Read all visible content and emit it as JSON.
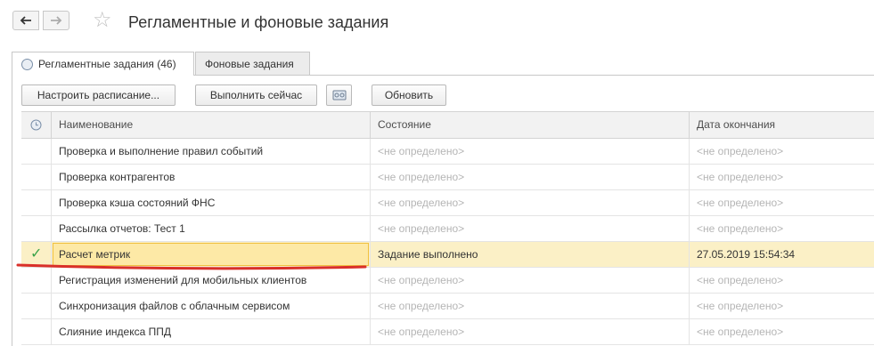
{
  "header": {
    "title": "Регламентные и фоновые задания"
  },
  "tabs": [
    {
      "label": "Регламентные задания (46)"
    },
    {
      "label": "Фоновые задания"
    }
  ],
  "toolbar": {
    "schedule_label": "Настроить расписание...",
    "run_label": "Выполнить сейчас",
    "refresh_label": "Обновить"
  },
  "table": {
    "columns": [
      "Наименование",
      "Состояние",
      "Дата окончания"
    ],
    "rows": [
      {
        "name": "Проверка и выполнение правил событий",
        "state": "<не определено>",
        "end": "<не определено>",
        "check": ""
      },
      {
        "name": "Проверка контрагентов",
        "state": "<не определено>",
        "end": "<не определено>",
        "check": ""
      },
      {
        "name": "Проверка кэша состояний ФНС",
        "state": "<не определено>",
        "end": "<не определено>",
        "check": ""
      },
      {
        "name": "Рассылка отчетов: Тест 1",
        "state": "<не определено>",
        "end": "<не определено>",
        "check": ""
      },
      {
        "name": "Расчет метрик",
        "state": "Задание выполнено",
        "end": "27.05.2019 15:54:34",
        "check": "✓"
      },
      {
        "name": "Регистрация изменений для мобильных клиентов",
        "state": "<не определено>",
        "end": "<не определено>",
        "check": ""
      },
      {
        "name": "Синхронизация файлов с облачным сервисом",
        "state": "<не определено>",
        "end": "<не определено>",
        "check": ""
      },
      {
        "name": "Слияние индекса ППД",
        "state": "<не определено>",
        "end": "<не определено>",
        "check": ""
      }
    ]
  },
  "colors": {
    "selected_row": "#fbf0c6",
    "selected_cell": "#fde9a6",
    "check": "#3aa34a",
    "annotation": "#d9302a"
  }
}
